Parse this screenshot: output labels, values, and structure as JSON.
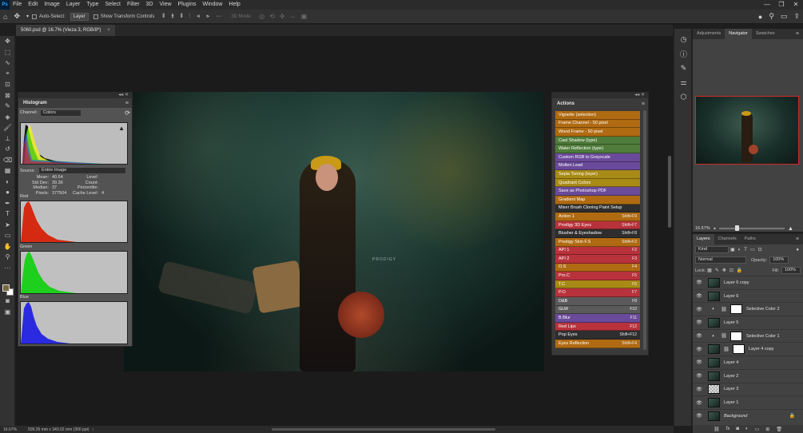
{
  "app": {
    "logo": "Ps",
    "menu": [
      "File",
      "Edit",
      "Image",
      "Layer",
      "Type",
      "Select",
      "Filter",
      "3D",
      "View",
      "Plugins",
      "Window",
      "Help"
    ],
    "window_controls": [
      "—",
      "❐",
      "✕"
    ]
  },
  "options_bar": {
    "auto_select_label": "Auto-Select:",
    "auto_select_value": "Layer",
    "show_transform_label": "Show Transform Controls",
    "mode_3d_label": "3D Mode:"
  },
  "document_tab": {
    "title": "5060.psd @ 16.7% (Vieza 3, RGB/8*)",
    "close": "×"
  },
  "canvas": {
    "watermark": "PRODIGY"
  },
  "status_bar": {
    "zoom": "16.67%",
    "doc_size": "509.26 mm x 340.02 mm (300 ppi)"
  },
  "histogram": {
    "title": "Histogram",
    "channel_label": "Channel:",
    "channel_value": "Colors",
    "source_label": "Source:",
    "source_value": "Entire Image",
    "stats_left": [
      {
        "k": "Mean:",
        "v": "40.64"
      },
      {
        "k": "Std Dev:",
        "v": "39.36"
      },
      {
        "k": "Median:",
        "v": "37"
      },
      {
        "k": "Pixels:",
        "v": "377504"
      }
    ],
    "stats_right": [
      {
        "k": "Level:",
        "v": ""
      },
      {
        "k": "Count:",
        "v": ""
      },
      {
        "k": "Percentile:",
        "v": ""
      },
      {
        "k": "Cache Level:",
        "v": "4"
      }
    ],
    "channels": {
      "red": "Red",
      "green": "Green",
      "blue": "Blue"
    }
  },
  "actions": {
    "title": "Actions",
    "items": [
      {
        "label": "Vignette (selection)",
        "key": "",
        "color": "#b06a12"
      },
      {
        "label": "Frame Channel - 50 pixel",
        "key": "",
        "color": "#b06a12"
      },
      {
        "label": "Wood Frame - 50 pixel",
        "key": "",
        "color": "#b06a12"
      },
      {
        "label": "Cast Shadow (type)",
        "key": "",
        "color": "#4f7c3a"
      },
      {
        "label": "Water Reflection (type)",
        "key": "",
        "color": "#4f7c3a"
      },
      {
        "label": "Custom RGB to Grayscale",
        "key": "",
        "color": "#6a4a9a"
      },
      {
        "label": "Molten Lead",
        "key": "",
        "color": "#6a4a9a"
      },
      {
        "label": "Sepia Toning (layer)",
        "key": "",
        "color": "#a88a16"
      },
      {
        "label": "Quadrant Colors",
        "key": "",
        "color": "#a88a16"
      },
      {
        "label": "Save as Photoshop PDF",
        "key": "",
        "color": "#6a4a9a"
      },
      {
        "label": "Gradient Map",
        "key": "",
        "color": "#b06a12"
      },
      {
        "label": "Mixer Brush Cloning Paint Setup",
        "key": "",
        "color": "#2e2e2e"
      },
      {
        "label": "Action 1",
        "key": "Shift+F9",
        "color": "#b06a12"
      },
      {
        "label": "Prodigy 3D Eyes",
        "key": "Shift+F7",
        "color": "#b8323c"
      },
      {
        "label": "Blusher & Eyeshadow",
        "key": "Shift+F8",
        "color": "#2e2e2e"
      },
      {
        "label": "Prodigy Skin F.S",
        "key": "Shift+F2",
        "color": "#b06a12"
      },
      {
        "label": "API 1",
        "key": "F2",
        "color": "#b8323c"
      },
      {
        "label": "API 2",
        "key": "F3",
        "color": "#b8323c"
      },
      {
        "label": "O.S",
        "key": "F4",
        "color": "#b06a12"
      },
      {
        "label": "Pro.C",
        "key": "F5",
        "color": "#b8323c"
      },
      {
        "label": "T.C",
        "key": "F6",
        "color": "#a88a16"
      },
      {
        "label": "P.O",
        "key": "F7",
        "color": "#b8323c"
      },
      {
        "label": "D&B",
        "key": "F8",
        "color": "#5a5a5a"
      },
      {
        "label": "GLW",
        "key": "F10",
        "color": "#5a5a5a"
      },
      {
        "label": "B.Blur",
        "key": "F11",
        "color": "#6a4a9a"
      },
      {
        "label": "Red Lips",
        "key": "F12",
        "color": "#b8323c"
      },
      {
        "label": "Pop Eyes",
        "key": "Shift+F12",
        "color": "#2e2e2e"
      },
      {
        "label": "Eyes Reflection",
        "key": "Shift+F4",
        "color": "#b06a12"
      }
    ]
  },
  "navigator": {
    "tabs": [
      "Adjustments",
      "Navigator",
      "Swatches"
    ],
    "active_tab": "Navigator",
    "zoom": "16.67%"
  },
  "layers": {
    "tabs": [
      "Layers",
      "Channels",
      "Paths"
    ],
    "active_tab": "Layers",
    "filter_label": "Kind",
    "blend_mode": "Normal",
    "opacity_label": "Opacity:",
    "opacity_value": "100%",
    "lock_label": "Lock:",
    "fill_label": "Fill:",
    "fill_value": "100%",
    "items": [
      {
        "name": "Layer 6 copy",
        "kind": "photo"
      },
      {
        "name": "Layer 6",
        "kind": "photo"
      },
      {
        "name": "Selective Color 2",
        "kind": "adjustment"
      },
      {
        "name": "Layer 5",
        "kind": "photo"
      },
      {
        "name": "Selective Color 1",
        "kind": "adjustment"
      },
      {
        "name": "Layer 4 copy",
        "kind": "masked"
      },
      {
        "name": "Layer 4",
        "kind": "photo"
      },
      {
        "name": "Layer 2",
        "kind": "photo"
      },
      {
        "name": "Layer 3",
        "kind": "transparent"
      },
      {
        "name": "Layer 1",
        "kind": "photo"
      },
      {
        "name": "Background",
        "kind": "background"
      }
    ],
    "bottom_icons": [
      "link-icon",
      "fx-icon",
      "mask-icon",
      "adjustment-icon",
      "group-icon",
      "new-layer-icon",
      "trash-icon"
    ]
  }
}
